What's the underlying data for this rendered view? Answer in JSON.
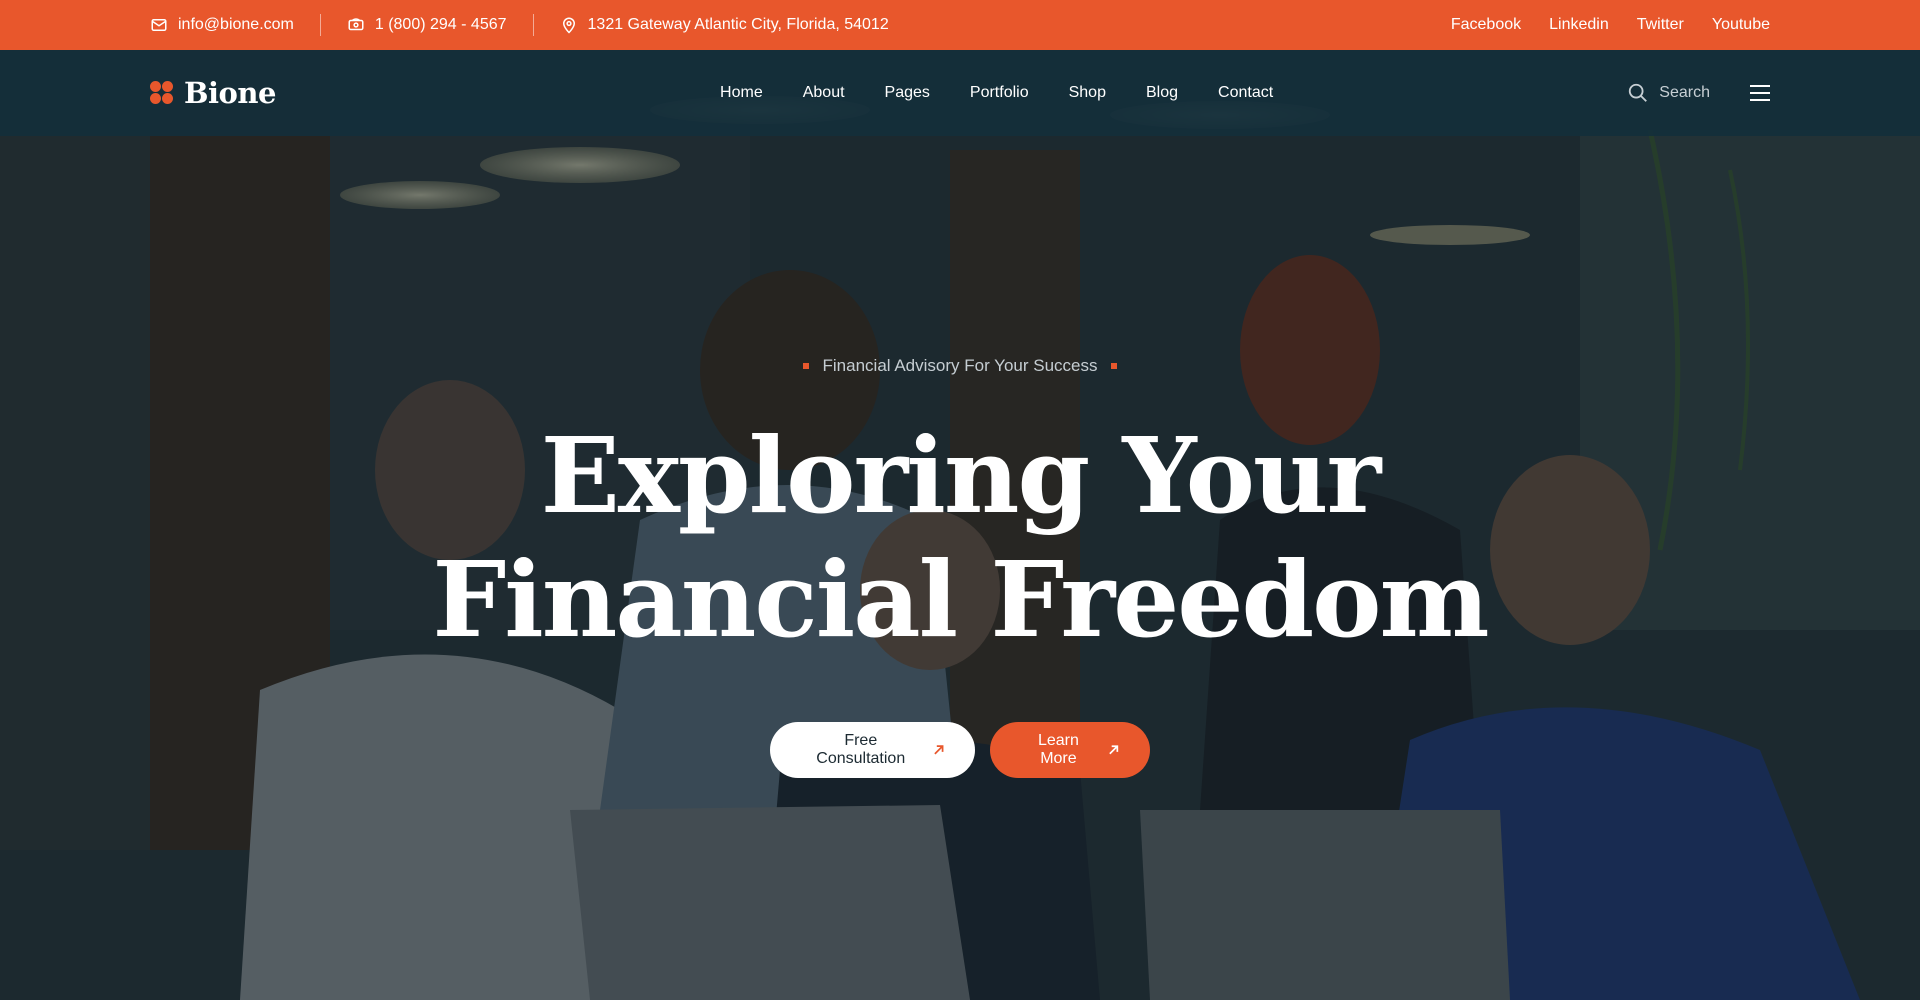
{
  "topbar": {
    "email": "info@bione.com",
    "phone": "1 (800) 294 - 4567",
    "address": "1321 Gateway Atlantic City, Florida, 54012",
    "socials": [
      "Facebook",
      "Linkedin",
      "Twitter",
      "Youtube"
    ]
  },
  "navbar": {
    "brand": "Bione",
    "menu": [
      "Home",
      "About",
      "Pages",
      "Portfolio",
      "Shop",
      "Blog",
      "Contact"
    ],
    "search_label": "Search"
  },
  "hero": {
    "eyebrow": "Financial Advisory For Your Success",
    "headline_line1": "Exploring Your",
    "headline_line2": "Financial Freedom",
    "primary_button": "Free Consultation",
    "secondary_button": "Learn More"
  },
  "colors": {
    "accent": "#e8572c",
    "nav_bg": "#132f3b"
  },
  "icons": {
    "email": "envelope-icon",
    "phone": "phone-icon",
    "address": "map-pin-icon",
    "search": "search-icon",
    "menu": "hamburger-icon",
    "button_arrow": "arrow-up-right-icon"
  }
}
